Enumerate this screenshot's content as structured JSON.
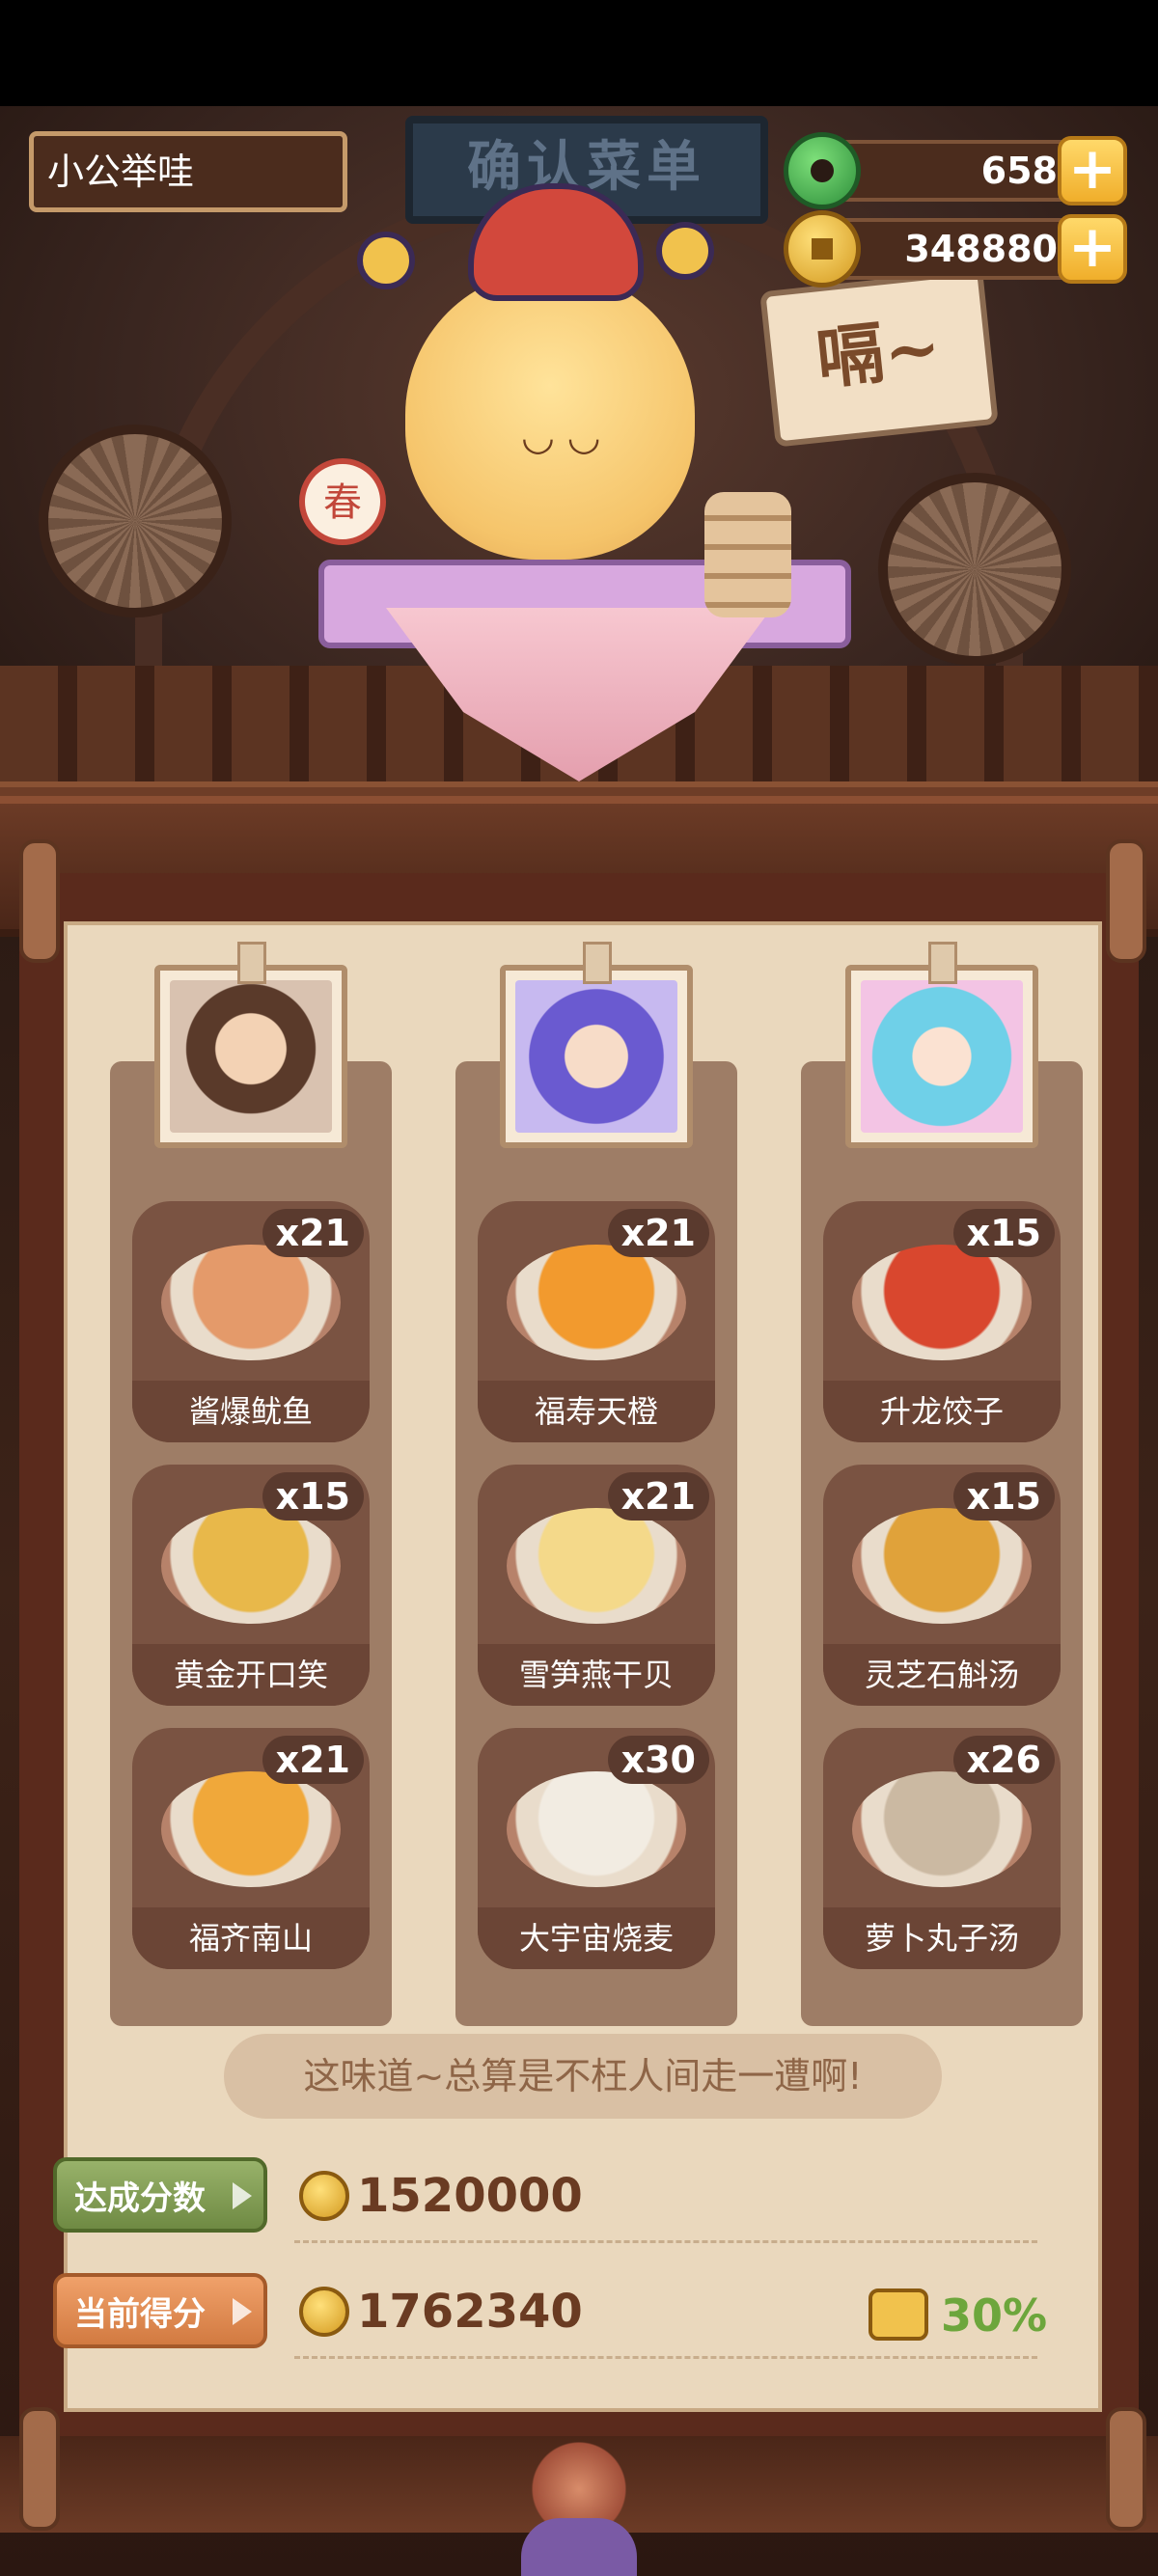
{
  "player": {
    "name": "小公举哇"
  },
  "resources": {
    "jade": "658",
    "gold": "348880"
  },
  "scene": {
    "sign_text": "确认菜单",
    "speech_bubble": "嗝~",
    "badge": "春"
  },
  "columns": [
    {
      "dishes": [
        {
          "name": "酱爆鱿鱼",
          "count": "x21",
          "color": "#e49a6a"
        },
        {
          "name": "黄金开口笑",
          "count": "x15",
          "color": "#e8b84a"
        },
        {
          "name": "福齐南山",
          "count": "x21",
          "color": "#f0a83a"
        }
      ]
    },
    {
      "dishes": [
        {
          "name": "福寿天橙",
          "count": "x21",
          "color": "#f29a2e"
        },
        {
          "name": "雪笋燕干贝",
          "count": "x21",
          "color": "#f4d98a"
        },
        {
          "name": "大宇宙烧麦",
          "count": "x30",
          "color": "#f2ece2"
        }
      ]
    },
    {
      "dishes": [
        {
          "name": "升龙饺子",
          "count": "x15",
          "color": "#d9472e"
        },
        {
          "name": "灵芝石斛汤",
          "count": "x15",
          "color": "#e0a23a"
        },
        {
          "name": "萝卜丸子汤",
          "count": "x26",
          "color": "#cbb9a2"
        }
      ]
    }
  ],
  "quote": "这味道~总算是不枉人间走一遭啊!",
  "target_score": {
    "label": "达成分数",
    "value": "1520000"
  },
  "current_score": {
    "label": "当前得分",
    "value": "1762340",
    "bonus": "30%"
  }
}
